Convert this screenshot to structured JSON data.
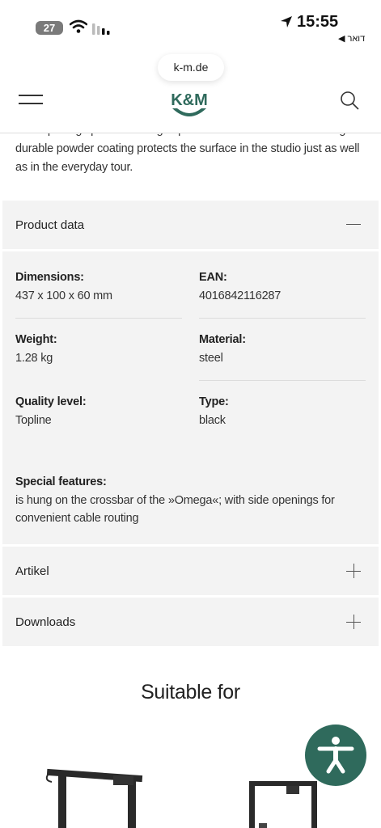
{
  "status_bar": {
    "time": "15:55",
    "battery": "27",
    "back_app": "◀ דואר"
  },
  "browser": {
    "url": "k-m.de"
  },
  "header": {
    "logo_text": "K&M",
    "brand_color": "#2f6a5c"
  },
  "intro": {
    "text": "Side openings provide enough space for convenient cable routing. The durable powder coating protects the surface in the studio just as well as in the everyday tour."
  },
  "product_data": {
    "title": "Product data",
    "dimensions_label": "Dimensions:",
    "dimensions_value": "437 x 100 x 60 mm",
    "ean_label": "EAN:",
    "ean_value": "4016842116287",
    "weight_label": "Weight:",
    "weight_value": "1.28 kg",
    "material_label": "Material:",
    "material_value": "steel",
    "quality_label": "Quality level:",
    "quality_value": "Topline",
    "type_label": "Type:",
    "type_value": "black",
    "special_label": "Special features:",
    "special_value_1": "is hung on the crossbar of the »Omega«; with side openings for",
    "special_value_2": "convenient cable routing"
  },
  "artikel": {
    "title": "Artikel"
  },
  "downloads": {
    "title": "Downloads"
  },
  "suitable": {
    "title": "Suitable for"
  }
}
